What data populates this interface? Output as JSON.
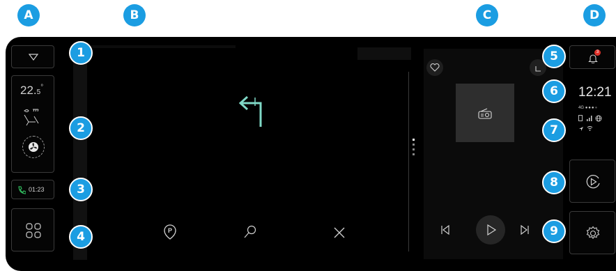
{
  "section_labels": [
    "A",
    "B",
    "C",
    "D"
  ],
  "callouts": [
    "1",
    "2",
    "3",
    "4",
    "5",
    "6",
    "7",
    "8",
    "9"
  ],
  "climate": {
    "temp_main": "22.",
    "temp_decimal": "5",
    "temp_unit": "°"
  },
  "call": {
    "duration": "01:23"
  },
  "notifications": {
    "count": "3"
  },
  "status": {
    "time": "12:21",
    "network": "4G"
  },
  "colors": {
    "accent": "#1b9de2",
    "nav_arrow": "#7fd8c6",
    "call_green": "#2fb35a",
    "badge_red": "#e0322a"
  }
}
